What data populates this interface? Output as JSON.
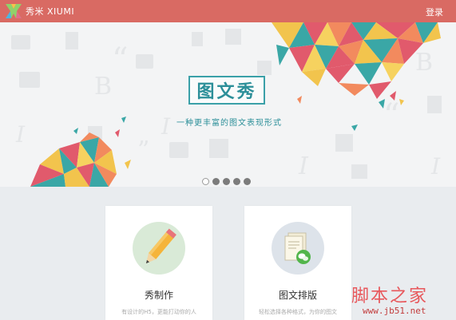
{
  "header": {
    "logo_text": "秀米 XIUMI",
    "login_label": "登录",
    "bar_color": "#d96a63"
  },
  "banner": {
    "title": "图文秀",
    "subtitle": "一种更丰富的图文表现形式",
    "carousel_dots": 5,
    "active_dot": 1
  },
  "cards": [
    {
      "icon": "pencil-icon",
      "title": "秀制作",
      "description": "有设计的H5，更能打动你的人"
    },
    {
      "icon": "document-wechat-icon",
      "title": "图文排版",
      "description": "轻松选择各种格式，为你的图文"
    }
  ],
  "watermark": {
    "text": "脚本之家",
    "url": "www.jb51.net"
  }
}
